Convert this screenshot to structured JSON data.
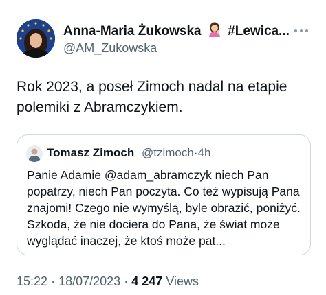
{
  "author": {
    "name": "Anna-Maria Żukowska",
    "tag": "#Lewica...",
    "handle": "@AM_Zukowska"
  },
  "tweet": {
    "text": "Rok 2023, a poseł Zimoch nadal na etapie polemiki z Abramczykiem."
  },
  "quote": {
    "name": "Tomasz Zimoch",
    "handle": "@tzimoch",
    "separator": "·",
    "time": "4h",
    "text": "Panie Adamie @adam_abramczyk niech Pan popatrzy, niech Pan poczyta. Co też wypisują Pana znajomi! Czego nie wymyślą, byle obrazić, poniżyć. Szkoda, że nie dociera do Pana, że świat może wyglądać inaczej, że ktoś może pat..."
  },
  "footer": {
    "time": "15:22",
    "dot1": "·",
    "date": "18/07/2023",
    "dot2": "·",
    "views_count": "4 247",
    "views_label": "Views"
  },
  "icons": {
    "emoji": "woman-tipping-hand-emoji",
    "more": "more-icon"
  },
  "colors": {
    "text": "#0f1419",
    "secondary": "#536471",
    "border": "#cfd9de",
    "avatar_bg": "#1d3f8f"
  }
}
